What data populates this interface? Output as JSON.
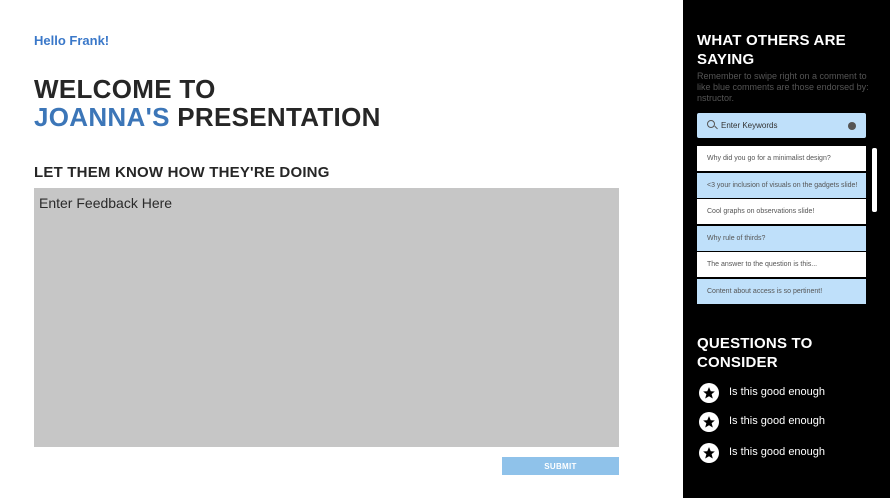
{
  "greeting": "Hello Frank!",
  "title": {
    "line1": "WELCOME TO",
    "name": "JOANNA'S",
    "rest": " PRESENTATION"
  },
  "feedback": {
    "heading": "LET THEM KNOW HOW THEY'RE DOING",
    "placeholder": "Enter Feedback Here"
  },
  "submit_label": "SUBMIT",
  "sidebar": {
    "title": "WHAT OTHERS ARE SAYING",
    "hint": "Remember to swipe right on a comment to like blue comments are those endorsed by: nstructor.",
    "search": {
      "placeholder": "Enter Keywords",
      "icon": "search-icon"
    },
    "comments": [
      {
        "text": "Why did you go for a minimalist design?",
        "endorsed": false
      },
      {
        "text": "<3 your inclusion of visuals on the gadgets slide!",
        "endorsed": true
      },
      {
        "text": "Cool graphs on observations slide!",
        "endorsed": false
      },
      {
        "text": "Why rule of thirds?",
        "endorsed": true
      },
      {
        "text": "The answer to the question is this...",
        "endorsed": false
      },
      {
        "text": "Content about access is so pertinent!",
        "endorsed": true
      }
    ],
    "questions_title": "QUESTIONS TO CONSIDER",
    "questions": [
      {
        "text": "Is this good enough",
        "icon": "star-icon"
      },
      {
        "text": "Is this good enough",
        "icon": "star-icon"
      },
      {
        "text": "Is this good enough",
        "icon": "star-icon"
      }
    ]
  },
  "colors": {
    "accent": "#3c76b8",
    "button": "#8fc2ea",
    "endorsed": "#bfe0fa",
    "panel": "#000000",
    "textarea": "#c6c6c6"
  }
}
